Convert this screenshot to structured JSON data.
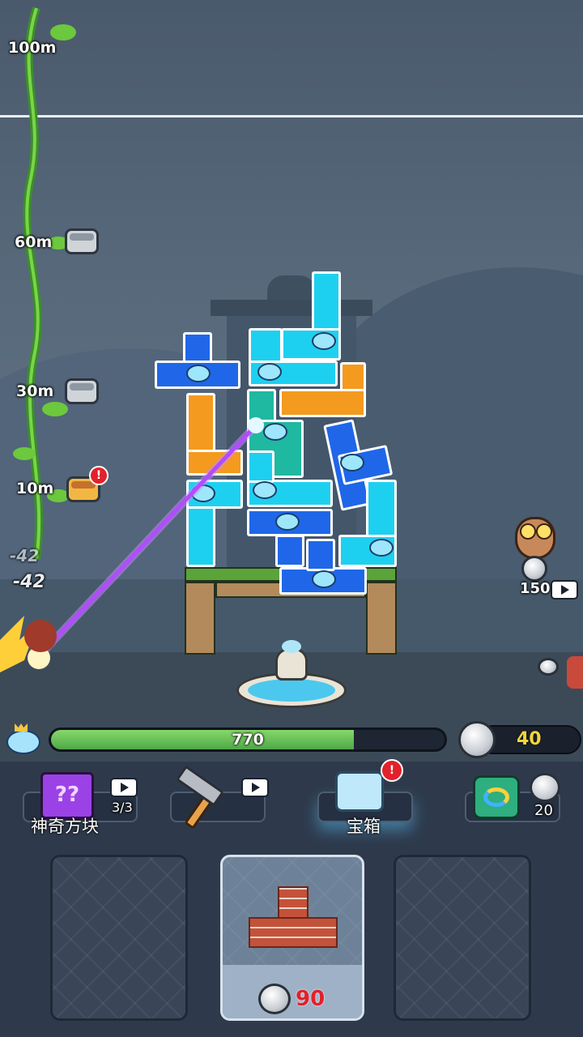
{
  "milestones": [
    {
      "label": "100m",
      "chest": "none"
    },
    {
      "label": "60m",
      "chest": "silver"
    },
    {
      "label": "30m",
      "chest": "silver"
    },
    {
      "label": "10m",
      "chest": "gold",
      "badge": "!"
    }
  ],
  "floating_scores": [
    "-42",
    "-42"
  ],
  "owl": {
    "cost": "150",
    "icon": "video-icon"
  },
  "hud": {
    "power_value": "770",
    "power_fraction": 0.77,
    "coins": "40"
  },
  "tools": {
    "magic_block": {
      "label": "神奇方块",
      "count": "3/3",
      "icon": "video-icon"
    },
    "hammer": {
      "icon": "video-icon"
    },
    "chest": {
      "label": "宝箱",
      "badge": "!"
    },
    "swap": {
      "cost": "20"
    }
  },
  "slots": [
    {
      "state": "empty"
    },
    {
      "state": "active",
      "price": "90",
      "piece": "T-brick"
    },
    {
      "state": "empty"
    }
  ],
  "colors": {
    "cyan_block": "#1ed0f0",
    "blue_block": "#1f67e8",
    "orange_block": "#f49a1e",
    "green_block": "#1fb8a1",
    "laser": "#b24cff",
    "price_red": "#e4202a",
    "coin_yellow": "#f3d43a"
  }
}
